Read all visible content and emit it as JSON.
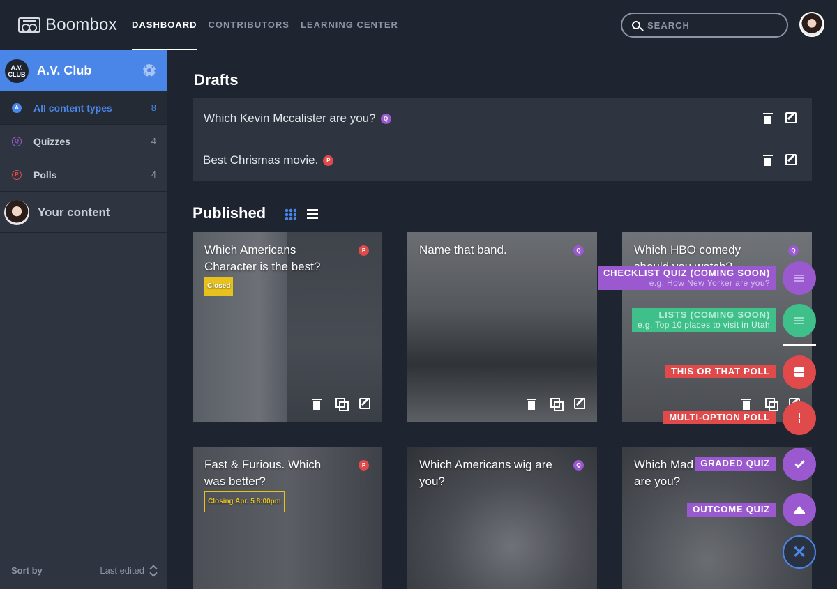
{
  "app": {
    "name": "Boombox"
  },
  "nav": [
    {
      "label": "DASHBOARD",
      "active": true
    },
    {
      "label": "CONTRIBUTORS",
      "active": false
    },
    {
      "label": "LEARNING CENTER",
      "active": false
    }
  ],
  "search": {
    "placeholder": "SEARCH"
  },
  "sidebar": {
    "org_logo": "A.V. CLUB",
    "org_name": "A.V. Club",
    "items": [
      {
        "badge": "A",
        "label": "All content types",
        "count": "8",
        "active": true,
        "badge_color": "#4a86e8"
      },
      {
        "badge": "Q",
        "label": "Quizzes",
        "count": "4",
        "active": false,
        "badge_color": "#9b59d0"
      },
      {
        "badge": "P",
        "label": "Polls",
        "count": "4",
        "active": false,
        "badge_color": "#e04a4a"
      }
    ],
    "your_content": "Your content",
    "sort_label": "Sort by",
    "sort_value": "Last edited"
  },
  "drafts": {
    "heading": "Drafts",
    "items": [
      {
        "title": "Which Kevin Mccalister are you?",
        "badge": "Q"
      },
      {
        "title": "Best Chrismas movie.",
        "badge": "P"
      }
    ]
  },
  "published": {
    "heading": "Published",
    "cards": [
      {
        "title": "Which Americans Character is the best?",
        "badge": "P",
        "tag": "Closed"
      },
      {
        "title": "Name that band.",
        "badge": "Q",
        "tag": ""
      },
      {
        "title": "Which HBO comedy should you watch?",
        "badge": "Q",
        "tag": ""
      },
      {
        "title": "Fast & Furious. Which was better?",
        "badge": "P",
        "tag": "Closing Apr. 5 8:00pm"
      },
      {
        "title": "Which Americans wig are you?",
        "badge": "Q",
        "tag": ""
      },
      {
        "title": "Which Mad Men character are you?",
        "badge": "Q",
        "tag": ""
      }
    ]
  },
  "fab_menu": [
    {
      "label": "CHECKLIST QUIZ (COMING SOON)",
      "sub": "e.g. How New Yorker are you?",
      "color": "#9b59d0"
    },
    {
      "label": "LISTS (COMING SOON)",
      "sub": "e.g. Top 10 places to visit in Utah",
      "color": "#3fbf8a"
    },
    {
      "label": "THIS OR THAT POLL",
      "sub": "",
      "color": "#e04a4a"
    },
    {
      "label": "MULTI-OPTION POLL",
      "sub": "",
      "color": "#e04a4a"
    },
    {
      "label": "GRADED QUIZ",
      "sub": "",
      "color": "#9b59d0"
    },
    {
      "label": "OUTCOME QUIZ",
      "sub": "",
      "color": "#9b59d0"
    }
  ],
  "fab_close": "✕"
}
